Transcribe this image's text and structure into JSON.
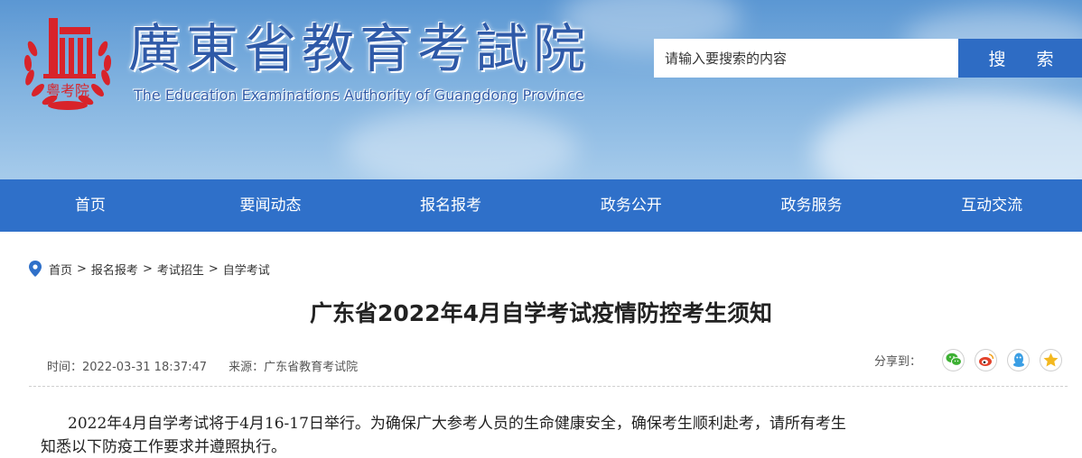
{
  "header": {
    "title": "廣東省教育考試院",
    "subtitle": "The Education Examinations Authority of Guangdong Province",
    "logo_text": "粤考院",
    "search": {
      "placeholder": "请输入要搜索的内容",
      "button_label": "搜 索"
    }
  },
  "nav": {
    "items": [
      {
        "label": "首页"
      },
      {
        "label": "要闻动态"
      },
      {
        "label": "报名报考"
      },
      {
        "label": "政务公开"
      },
      {
        "label": "政务服务"
      },
      {
        "label": "互动交流"
      }
    ]
  },
  "breadcrumb": {
    "items": [
      {
        "label": "首页"
      },
      {
        "label": "报名报考"
      },
      {
        "label": "考试招生"
      },
      {
        "label": "自学考试"
      }
    ],
    "separator": ">"
  },
  "article": {
    "title": "广东省2022年4月自学考试疫情防控考生须知",
    "time": "时间：2022-03-31 18:37:47",
    "source": "来源：广东省教育考试院",
    "share_label": "分享到：",
    "share_icons": [
      "wechat-icon",
      "weibo-icon",
      "qq-icon",
      "qzone-icon"
    ],
    "body_line_1": "2022年4月自学考试将于4月16-17日举行。为确保广大参考人员的生命健康安全，确保考生顺利赴考，请所有考生",
    "body_line_2": "知悉以下防疫工作要求并遵照执行。"
  },
  "colors": {
    "brand_blue": "#2f70c9",
    "search_button": "#2e6cc4",
    "logo_red": "#d8232a",
    "wechat_green": "#3db033",
    "weibo_red": "#e2422b",
    "qq_blue": "#3a9ee4",
    "qzone_yellow": "#f3b81f"
  }
}
